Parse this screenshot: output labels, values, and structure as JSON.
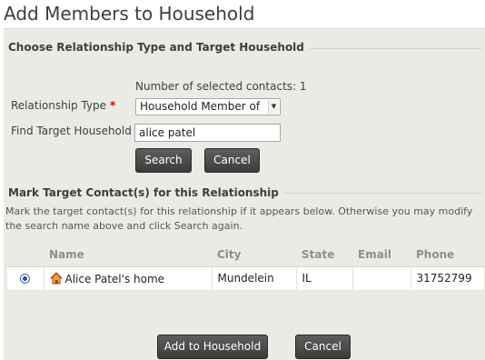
{
  "page": {
    "title": "Add Members to Household"
  },
  "relationship_section": {
    "legend": "Choose Relationship Type and Target Household",
    "selected_count_text": "Number of selected contacts: 1",
    "relationship_type_label": "Relationship Type",
    "required_marker": "*",
    "relationship_type_value": "Household Member of",
    "find_label": "Find Target Household",
    "find_value": "alice patel",
    "search_button": "Search",
    "cancel_button": "Cancel"
  },
  "mark_section": {
    "legend": "Mark Target Contact(s) for this Relationship",
    "help_text": "Mark the target contact(s) for this relationship if it appears below. Otherwise you may modify the search name above and click Search again.",
    "columns": [
      "",
      "Name",
      "City",
      "State",
      "Email",
      "Phone"
    ],
    "rows": [
      {
        "selected": true,
        "icon": "household-icon",
        "name": "Alice Patel's home",
        "city": "Mundelein",
        "state": "IL",
        "email": "",
        "phone": "31752799"
      }
    ]
  },
  "footer": {
    "add_button": "Add to Household",
    "cancel_button": "Cancel"
  },
  "colors": {
    "accent_red": "#cc0000",
    "button_dark": "#4a4a4a",
    "panel_bg": "#ebebe6"
  }
}
